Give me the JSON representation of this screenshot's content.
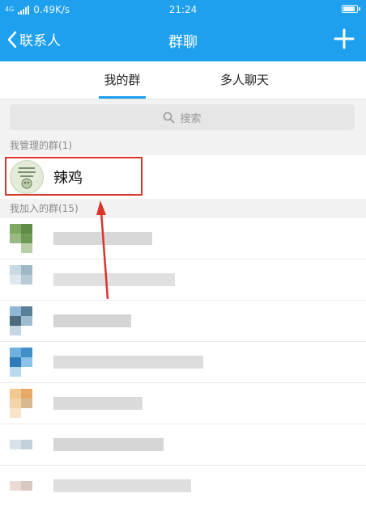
{
  "status_bar": {
    "network_type": "4G",
    "speed": "0.49K/s",
    "time": "21:24"
  },
  "navbar": {
    "back_label": "联系人",
    "title": "群聊",
    "add_icon": "plus-icon"
  },
  "tabs": [
    {
      "label": "我的群",
      "active": true
    },
    {
      "label": "多人聊天",
      "active": false
    }
  ],
  "search": {
    "placeholder": "搜索",
    "icon": "search-icon"
  },
  "managed_section": {
    "header": "我管理的群(1)",
    "groups": [
      {
        "name": "辣鸡"
      }
    ]
  },
  "joined_section": {
    "header": "我加入的群(15)"
  },
  "colors": {
    "accent": "#1ea0ee",
    "highlight_box": "#d9342b",
    "arrow": "#d9342b",
    "background": "#f2f2f2"
  }
}
